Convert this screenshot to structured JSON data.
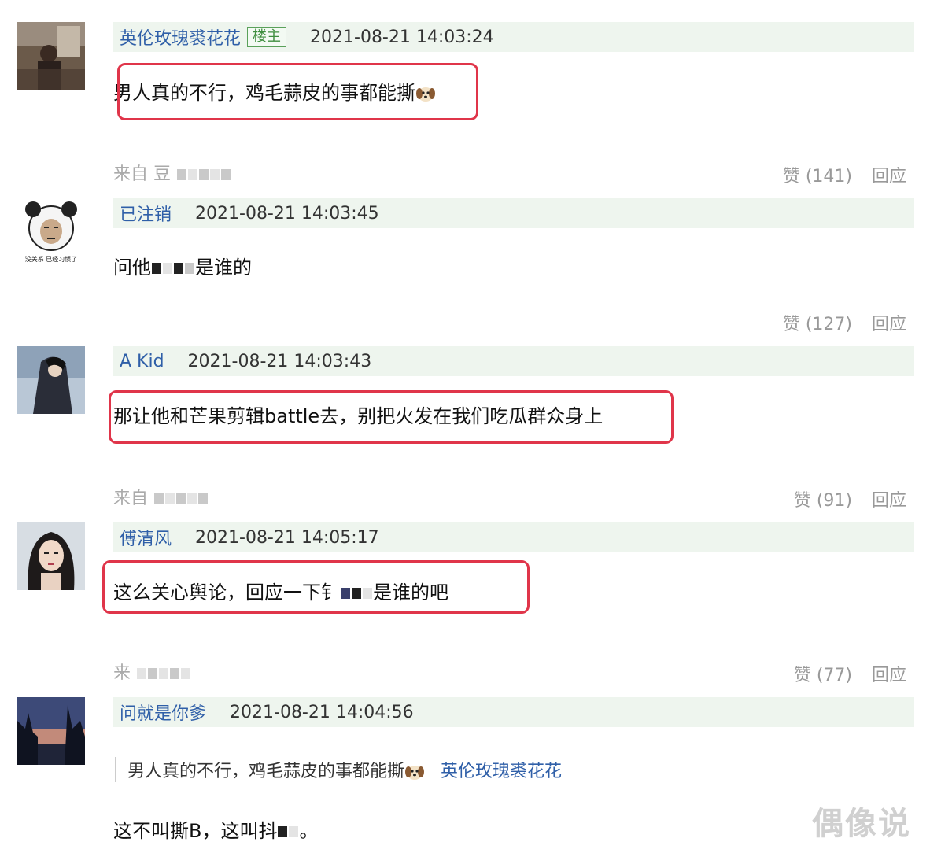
{
  "comments": [
    {
      "author": "英伦玫瑰裘花花",
      "badge": "楼主",
      "time": "2021-08-21 14:03:24",
      "text": "男人真的不行，鸡毛蒜皮的事都能撕",
      "from_label": "来自 豆",
      "likes": "赞 (141)",
      "reply": "回应"
    },
    {
      "author": "已注销",
      "time": "2021-08-21 14:03:45",
      "text_pre": "问他",
      "text_post": "是谁的",
      "avatar_caption": "没关系 已经习惯了",
      "likes": "赞 (127)",
      "reply": "回应"
    },
    {
      "author": "A Kid",
      "time": "2021-08-21 14:03:43",
      "text": "那让他和芒果剪辑battle去，别把火发在我们吃瓜群众身上",
      "from_label": "来自",
      "likes": "赞 (91)",
      "reply": "回应"
    },
    {
      "author": "傅清风",
      "time": "2021-08-21 14:05:17",
      "text_pre": "这么关心舆论，回应一下钅",
      "text_post": "是谁的吧",
      "from_label": "来",
      "likes": "赞 (77)",
      "reply": "回应"
    },
    {
      "author": "问就是你爹",
      "time": "2021-08-21 14:04:56",
      "quote_text": "男人真的不行，鸡毛蒜皮的事都能撕",
      "quote_author": "英伦玫瑰裘花花",
      "text_pre": "这不叫撕B，这叫抖",
      "text_post": "。"
    }
  ],
  "watermark": "偶像说",
  "colors": {
    "link": "#2f5fa8",
    "highlight_box": "#e0354a",
    "header_bg": "#eef5ee"
  }
}
